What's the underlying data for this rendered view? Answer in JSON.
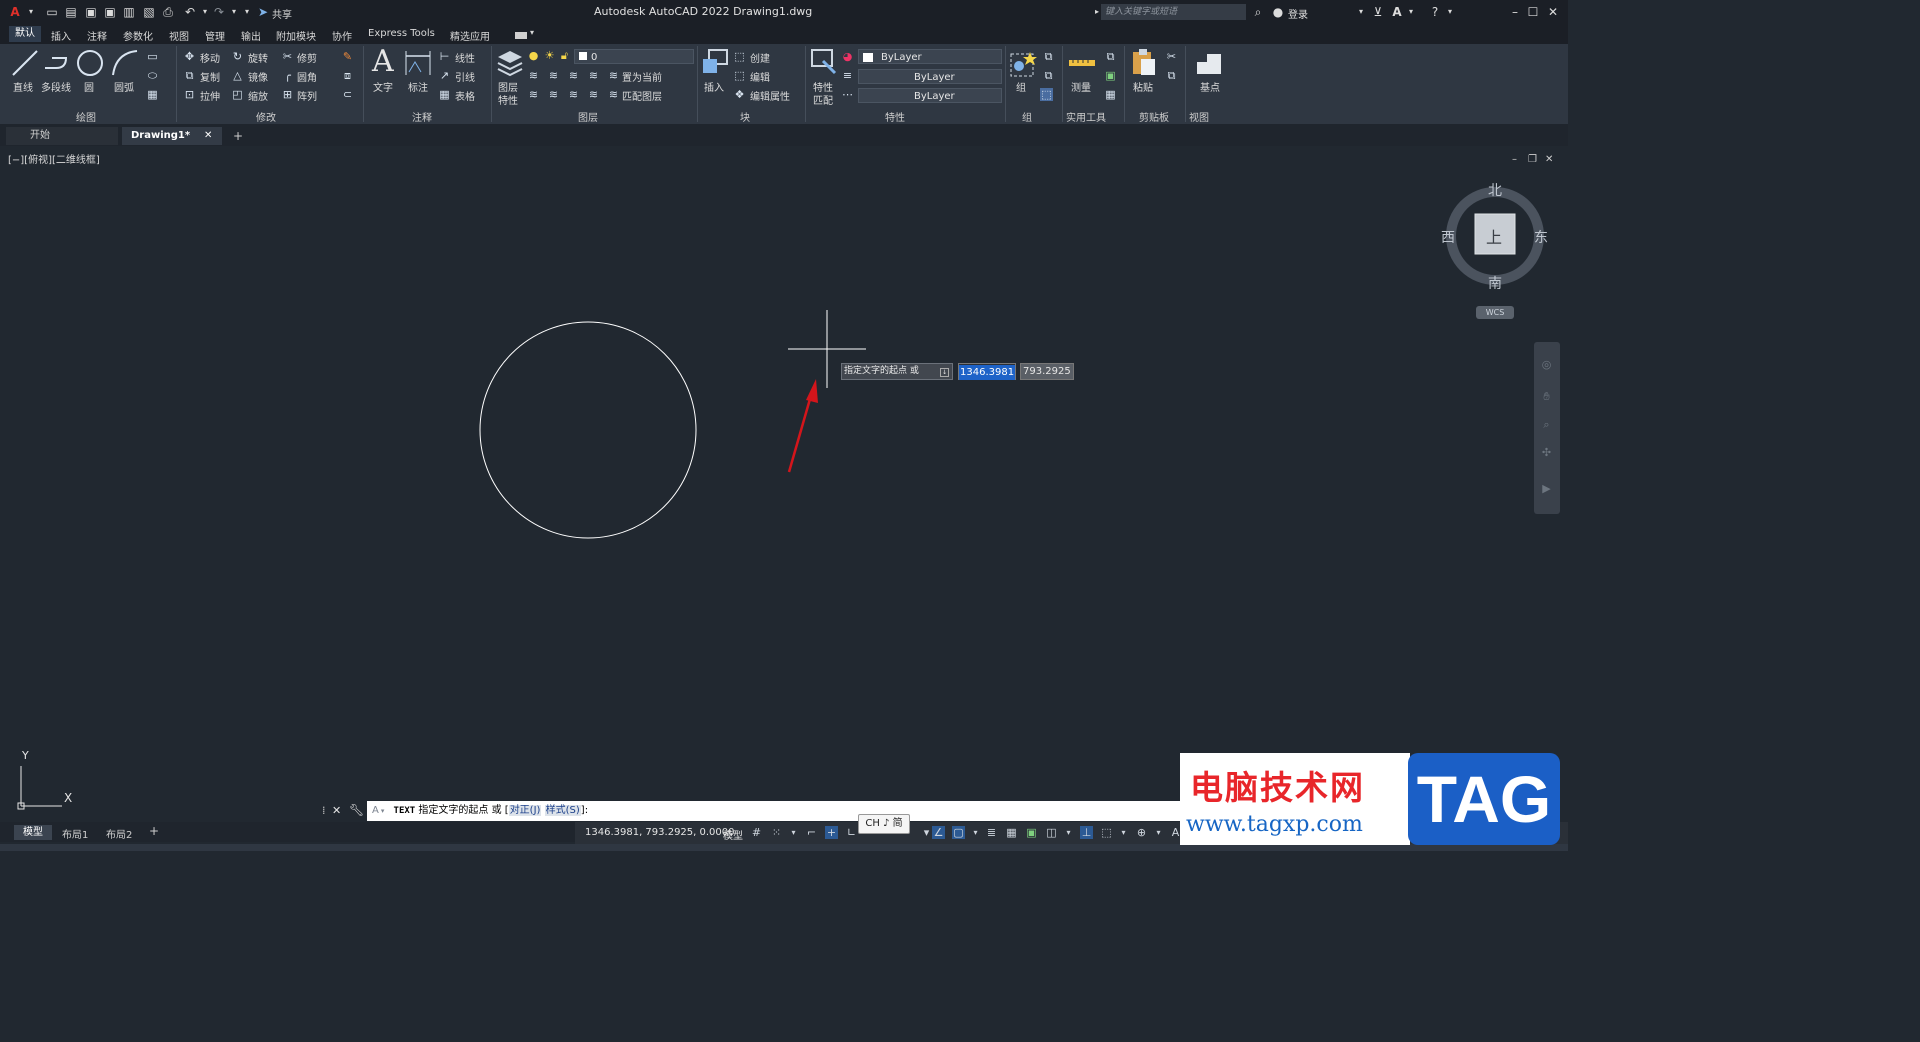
{
  "titlebar": {
    "title": "Autodesk AutoCAD 2022    Drawing1.dwg",
    "share": "共享",
    "search_placeholder": "键入关键字或短语",
    "login": "登录"
  },
  "menu": [
    "默认",
    "插入",
    "注释",
    "参数化",
    "视图",
    "管理",
    "输出",
    "附加模块",
    "协作",
    "Express Tools",
    "精选应用"
  ],
  "ribbon": {
    "draw": {
      "line": "直线",
      "polyline": "多段线",
      "circle": "圆",
      "arc": "圆弧",
      "title": "绘图"
    },
    "modify": {
      "move": "移动",
      "rotate": "旋转",
      "trim": "修剪",
      "copy": "复制",
      "mirror": "镜像",
      "fillet": "圆角",
      "stretch": "拉伸",
      "scale": "缩放",
      "array": "阵列",
      "title": "修改"
    },
    "annotate": {
      "text": "文字",
      "dim": "标注",
      "linear": "线性",
      "leader": "引线",
      "table": "表格",
      "title": "注释"
    },
    "layers": {
      "props_line1": "图层",
      "props_line2": "特性",
      "layer_value": "0",
      "set_current": "置为当前",
      "match_layer": "匹配图层",
      "title": "图层"
    },
    "block": {
      "insert": "插入",
      "create": "创建",
      "edit": "编辑",
      "edit_attr": "编辑属性",
      "title": "块"
    },
    "properties": {
      "match_line1": "特性",
      "match_line2": "匹配",
      "color": "ByLayer",
      "linetype": "ByLayer",
      "lineweight": "ByLayer",
      "title": "特性"
    },
    "groups": {
      "group": "组",
      "title": "组"
    },
    "utilities": {
      "measure": "测量",
      "title": "实用工具"
    },
    "clipboard": {
      "paste": "粘贴",
      "title": "剪贴板"
    },
    "view": {
      "base": "基点",
      "title": "视图"
    }
  },
  "doctabs": {
    "start": "开始",
    "drawing": "Drawing1*"
  },
  "viewport": {
    "label": "[−][俯视][二维线框]"
  },
  "viewcube": {
    "north": "北",
    "south": "南",
    "east": "东",
    "west": "西",
    "top": "上",
    "wcs": "WCS"
  },
  "dynamic_input": {
    "prompt": "指定文字的起点 或",
    "x": "1346.3981",
    "y": "793.2925"
  },
  "command_line": {
    "cmd": "TEXT",
    "prompt": "指定文字的起点 或 [",
    "opt1": "对正(J)",
    "opt2": "样式(S)",
    "end": "]:"
  },
  "layout_tabs": [
    "模型",
    "布局1",
    "布局2"
  ],
  "status": {
    "coords": "1346.3981, 793.2925, 0.0000",
    "model": "模型",
    "ime": "CH ♪ 简"
  },
  "watermark": {
    "title": "电脑技术网",
    "url": "www.tagxp.com",
    "tag": "TAG"
  },
  "ucs": {
    "x": "X",
    "y": "Y"
  },
  "colors": {
    "accent": "#1e63c8",
    "arrow": "#d4151b",
    "canvas": "#212830"
  }
}
